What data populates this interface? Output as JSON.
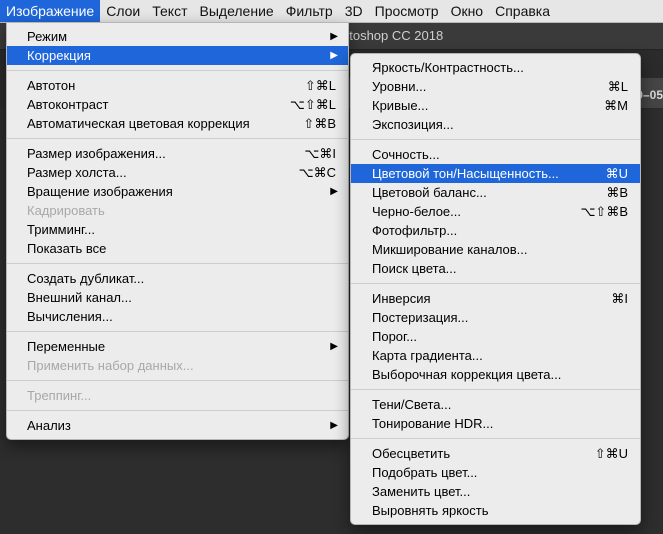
{
  "menubar": [
    {
      "label": "Изображение",
      "active": true
    },
    {
      "label": "Слои"
    },
    {
      "label": "Текст"
    },
    {
      "label": "Выделение"
    },
    {
      "label": "Фильтр"
    },
    {
      "label": "3D"
    },
    {
      "label": "Просмотр"
    },
    {
      "label": "Окно"
    },
    {
      "label": "Справка"
    }
  ],
  "app": {
    "title_fragment": "otoshop CC 2018",
    "doc_tab_fragment": "0–05"
  },
  "main_menu": {
    "groups": [
      [
        {
          "label": "Режим",
          "submenu": true
        },
        {
          "label": "Коррекция",
          "submenu": true,
          "highlight": true
        }
      ],
      [
        {
          "label": "Автотон",
          "shortcut": "⇧⌘L"
        },
        {
          "label": "Автоконтраст",
          "shortcut": "⌥⇧⌘L"
        },
        {
          "label": "Автоматическая цветовая коррекция",
          "shortcut": "⇧⌘B"
        }
      ],
      [
        {
          "label": "Размер изображения...",
          "shortcut": "⌥⌘I"
        },
        {
          "label": "Размер холста...",
          "shortcut": "⌥⌘C"
        },
        {
          "label": "Вращение изображения",
          "submenu": true
        },
        {
          "label": "Кадрировать",
          "disabled": true
        },
        {
          "label": "Тримминг..."
        },
        {
          "label": "Показать все"
        }
      ],
      [
        {
          "label": "Создать дубликат..."
        },
        {
          "label": "Внешний канал..."
        },
        {
          "label": "Вычисления..."
        }
      ],
      [
        {
          "label": "Переменные",
          "submenu": true
        },
        {
          "label": "Применить набор данных...",
          "disabled": true
        }
      ],
      [
        {
          "label": "Треппинг...",
          "disabled": true
        }
      ],
      [
        {
          "label": "Анализ",
          "submenu": true
        }
      ]
    ]
  },
  "sub_menu": {
    "groups": [
      [
        {
          "label": "Яркость/Контрастность..."
        },
        {
          "label": "Уровни...",
          "shortcut": "⌘L"
        },
        {
          "label": "Кривые...",
          "shortcut": "⌘M"
        },
        {
          "label": "Экспозиция..."
        }
      ],
      [
        {
          "label": "Сочность..."
        },
        {
          "label": "Цветовой тон/Насыщенность...",
          "shortcut": "⌘U",
          "highlight": true
        },
        {
          "label": "Цветовой баланс...",
          "shortcut": "⌘B"
        },
        {
          "label": "Черно-белое...",
          "shortcut": "⌥⇧⌘B"
        },
        {
          "label": "Фотофильтр..."
        },
        {
          "label": "Микширование каналов..."
        },
        {
          "label": "Поиск цвета..."
        }
      ],
      [
        {
          "label": "Инверсия",
          "shortcut": "⌘I"
        },
        {
          "label": "Постеризация..."
        },
        {
          "label": "Порог..."
        },
        {
          "label": "Карта градиента..."
        },
        {
          "label": "Выборочная коррекция цвета..."
        }
      ],
      [
        {
          "label": "Тени/Света..."
        },
        {
          "label": "Тонирование HDR..."
        }
      ],
      [
        {
          "label": "Обесцветить",
          "shortcut": "⇧⌘U"
        },
        {
          "label": "Подобрать цвет..."
        },
        {
          "label": "Заменить цвет..."
        },
        {
          "label": "Выровнять яркость"
        }
      ]
    ]
  },
  "colors": {
    "highlight": "#1e66d9",
    "menu_bg": "#ececec",
    "disabled_text": "#a8a8a8"
  }
}
